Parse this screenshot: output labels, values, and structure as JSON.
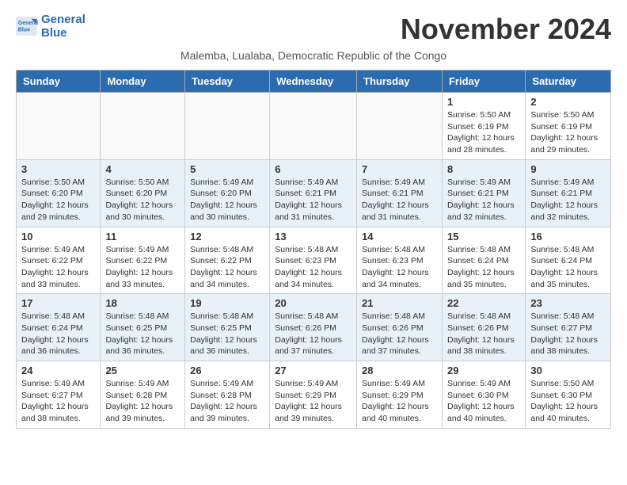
{
  "header": {
    "logo_line1": "General",
    "logo_line2": "Blue",
    "month_title": "November 2024",
    "subtitle": "Malemba, Lualaba, Democratic Republic of the Congo"
  },
  "weekdays": [
    "Sunday",
    "Monday",
    "Tuesday",
    "Wednesday",
    "Thursday",
    "Friday",
    "Saturday"
  ],
  "weeks": [
    [
      {
        "day": "",
        "info": ""
      },
      {
        "day": "",
        "info": ""
      },
      {
        "day": "",
        "info": ""
      },
      {
        "day": "",
        "info": ""
      },
      {
        "day": "",
        "info": ""
      },
      {
        "day": "1",
        "info": "Sunrise: 5:50 AM\nSunset: 6:19 PM\nDaylight: 12 hours and 28 minutes."
      },
      {
        "day": "2",
        "info": "Sunrise: 5:50 AM\nSunset: 6:19 PM\nDaylight: 12 hours and 29 minutes."
      }
    ],
    [
      {
        "day": "3",
        "info": "Sunrise: 5:50 AM\nSunset: 6:20 PM\nDaylight: 12 hours and 29 minutes."
      },
      {
        "day": "4",
        "info": "Sunrise: 5:50 AM\nSunset: 6:20 PM\nDaylight: 12 hours and 30 minutes."
      },
      {
        "day": "5",
        "info": "Sunrise: 5:49 AM\nSunset: 6:20 PM\nDaylight: 12 hours and 30 minutes."
      },
      {
        "day": "6",
        "info": "Sunrise: 5:49 AM\nSunset: 6:21 PM\nDaylight: 12 hours and 31 minutes."
      },
      {
        "day": "7",
        "info": "Sunrise: 5:49 AM\nSunset: 6:21 PM\nDaylight: 12 hours and 31 minutes."
      },
      {
        "day": "8",
        "info": "Sunrise: 5:49 AM\nSunset: 6:21 PM\nDaylight: 12 hours and 32 minutes."
      },
      {
        "day": "9",
        "info": "Sunrise: 5:49 AM\nSunset: 6:21 PM\nDaylight: 12 hours and 32 minutes."
      }
    ],
    [
      {
        "day": "10",
        "info": "Sunrise: 5:49 AM\nSunset: 6:22 PM\nDaylight: 12 hours and 33 minutes."
      },
      {
        "day": "11",
        "info": "Sunrise: 5:49 AM\nSunset: 6:22 PM\nDaylight: 12 hours and 33 minutes."
      },
      {
        "day": "12",
        "info": "Sunrise: 5:48 AM\nSunset: 6:22 PM\nDaylight: 12 hours and 34 minutes."
      },
      {
        "day": "13",
        "info": "Sunrise: 5:48 AM\nSunset: 6:23 PM\nDaylight: 12 hours and 34 minutes."
      },
      {
        "day": "14",
        "info": "Sunrise: 5:48 AM\nSunset: 6:23 PM\nDaylight: 12 hours and 34 minutes."
      },
      {
        "day": "15",
        "info": "Sunrise: 5:48 AM\nSunset: 6:24 PM\nDaylight: 12 hours and 35 minutes."
      },
      {
        "day": "16",
        "info": "Sunrise: 5:48 AM\nSunset: 6:24 PM\nDaylight: 12 hours and 35 minutes."
      }
    ],
    [
      {
        "day": "17",
        "info": "Sunrise: 5:48 AM\nSunset: 6:24 PM\nDaylight: 12 hours and 36 minutes."
      },
      {
        "day": "18",
        "info": "Sunrise: 5:48 AM\nSunset: 6:25 PM\nDaylight: 12 hours and 36 minutes."
      },
      {
        "day": "19",
        "info": "Sunrise: 5:48 AM\nSunset: 6:25 PM\nDaylight: 12 hours and 36 minutes."
      },
      {
        "day": "20",
        "info": "Sunrise: 5:48 AM\nSunset: 6:26 PM\nDaylight: 12 hours and 37 minutes."
      },
      {
        "day": "21",
        "info": "Sunrise: 5:48 AM\nSunset: 6:26 PM\nDaylight: 12 hours and 37 minutes."
      },
      {
        "day": "22",
        "info": "Sunrise: 5:48 AM\nSunset: 6:26 PM\nDaylight: 12 hours and 38 minutes."
      },
      {
        "day": "23",
        "info": "Sunrise: 5:48 AM\nSunset: 6:27 PM\nDaylight: 12 hours and 38 minutes."
      }
    ],
    [
      {
        "day": "24",
        "info": "Sunrise: 5:49 AM\nSunset: 6:27 PM\nDaylight: 12 hours and 38 minutes."
      },
      {
        "day": "25",
        "info": "Sunrise: 5:49 AM\nSunset: 6:28 PM\nDaylight: 12 hours and 39 minutes."
      },
      {
        "day": "26",
        "info": "Sunrise: 5:49 AM\nSunset: 6:28 PM\nDaylight: 12 hours and 39 minutes."
      },
      {
        "day": "27",
        "info": "Sunrise: 5:49 AM\nSunset: 6:29 PM\nDaylight: 12 hours and 39 minutes."
      },
      {
        "day": "28",
        "info": "Sunrise: 5:49 AM\nSunset: 6:29 PM\nDaylight: 12 hours and 40 minutes."
      },
      {
        "day": "29",
        "info": "Sunrise: 5:49 AM\nSunset: 6:30 PM\nDaylight: 12 hours and 40 minutes."
      },
      {
        "day": "30",
        "info": "Sunrise: 5:50 AM\nSunset: 6:30 PM\nDaylight: 12 hours and 40 minutes."
      }
    ]
  ]
}
